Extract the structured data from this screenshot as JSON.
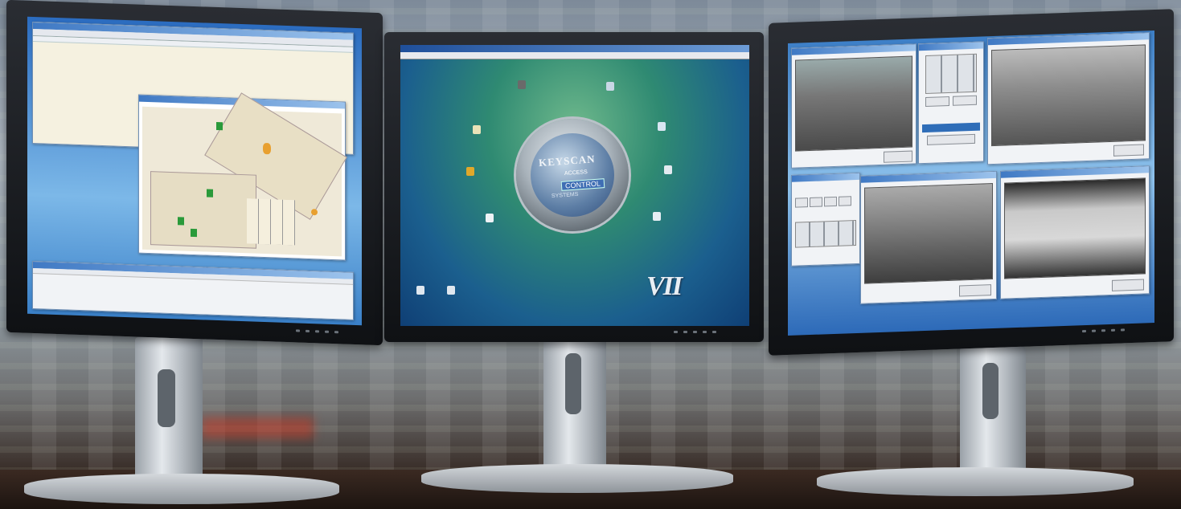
{
  "scene": {
    "description_colors": {
      "screen_blue": "#1e5fb0",
      "desktop_green": "#3a8f6e",
      "accent": "#2f6db8"
    }
  },
  "center_monitor": {
    "logo": {
      "brand": "KEYSCAN",
      "tag1": "ACCESS",
      "tag2": "CONTROL",
      "tag3": "SYSTEMS"
    },
    "version_mark": "VII"
  }
}
